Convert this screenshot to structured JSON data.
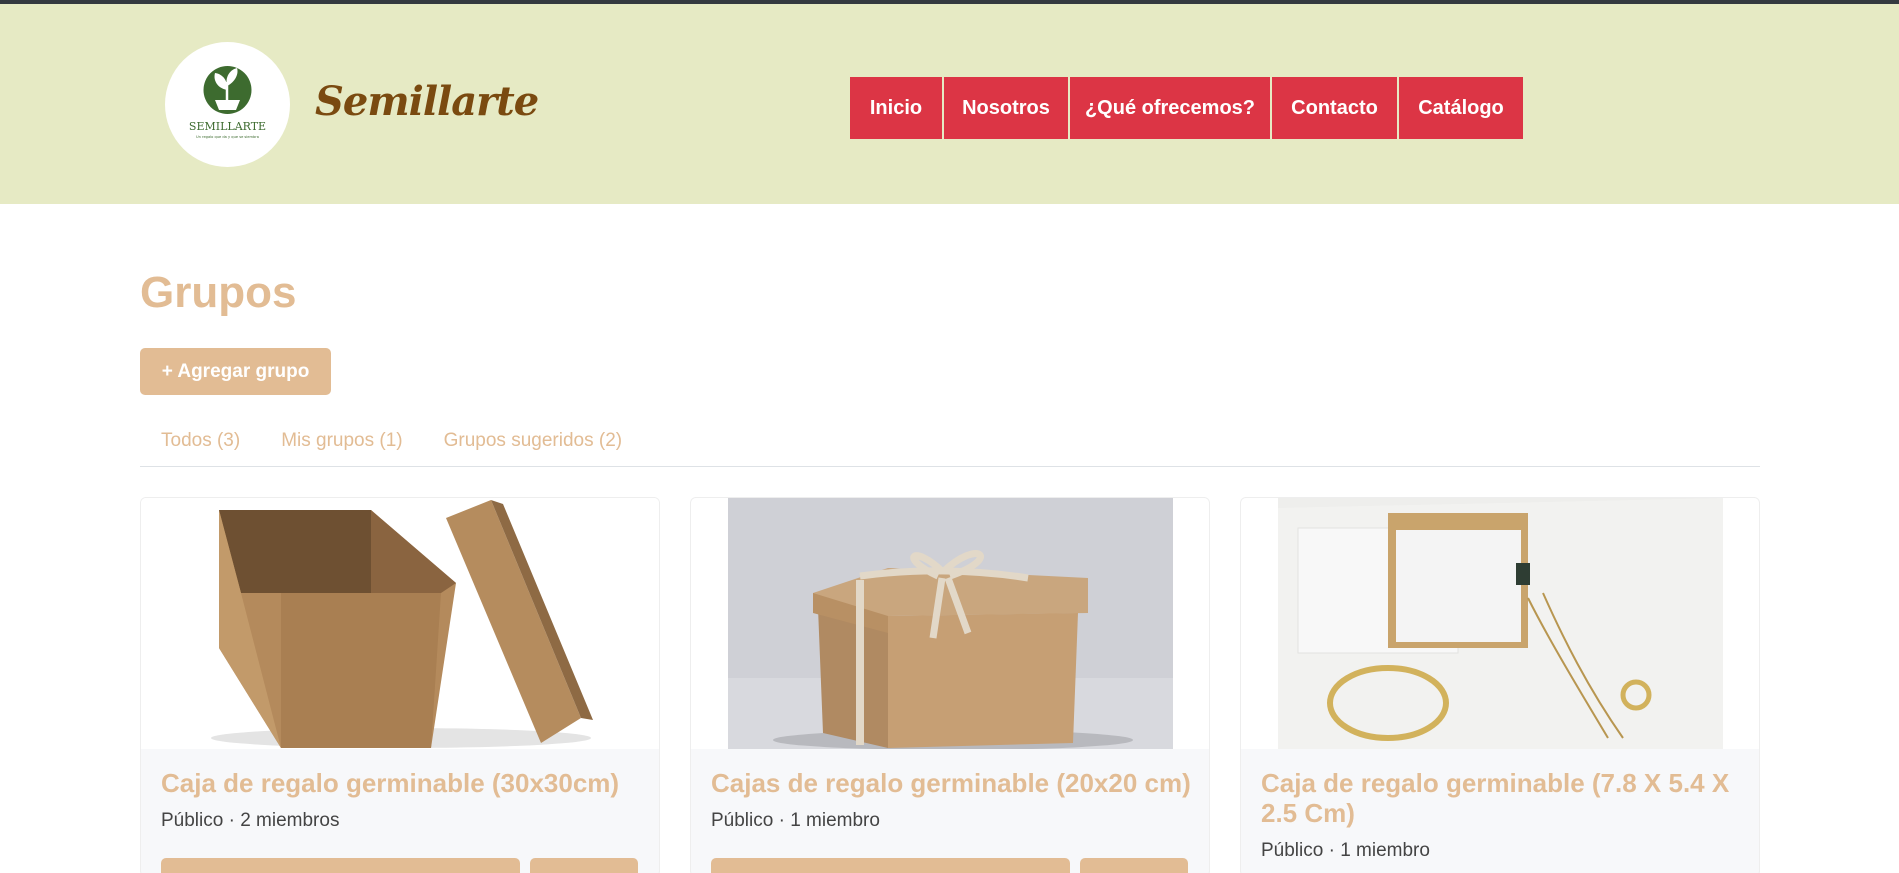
{
  "brand": {
    "name": "Semillarte",
    "logo_text": "SEMILLARTE",
    "logo_tagline": "Un regalo que da y que se siembra"
  },
  "nav": {
    "items": [
      {
        "label": "Inicio"
      },
      {
        "label": "Nosotros"
      },
      {
        "label": "¿Qué ofrecemos?"
      },
      {
        "label": "Contacto"
      },
      {
        "label": "Catálogo"
      }
    ]
  },
  "page": {
    "title": "Grupos",
    "add_button": "+ Agregar grupo"
  },
  "tabs": [
    {
      "label": "Todos (3)"
    },
    {
      "label": "Mis grupos (1)"
    },
    {
      "label": "Grupos sugeridos (2)"
    }
  ],
  "groups": [
    {
      "title": "Caja de regalo germinable (30x30cm)",
      "meta": "Público · 2 miembros",
      "image": "open-kraft-box"
    },
    {
      "title": "Cajas de regalo germinable (20x20 cm)",
      "meta": "Público · 1 miembro",
      "image": "kraft-box-with-ribbon"
    },
    {
      "title": "Caja de regalo germinable (7.8 X 5.4 X 2.5 Cm)",
      "meta": "Público · 1 miembro",
      "image": "jewelry-box-with-bracelet"
    }
  ],
  "colors": {
    "accent": "#e2bc94",
    "nav": "#dc3545",
    "header_bg": "#e6eac4",
    "brand": "#7a4a10"
  }
}
